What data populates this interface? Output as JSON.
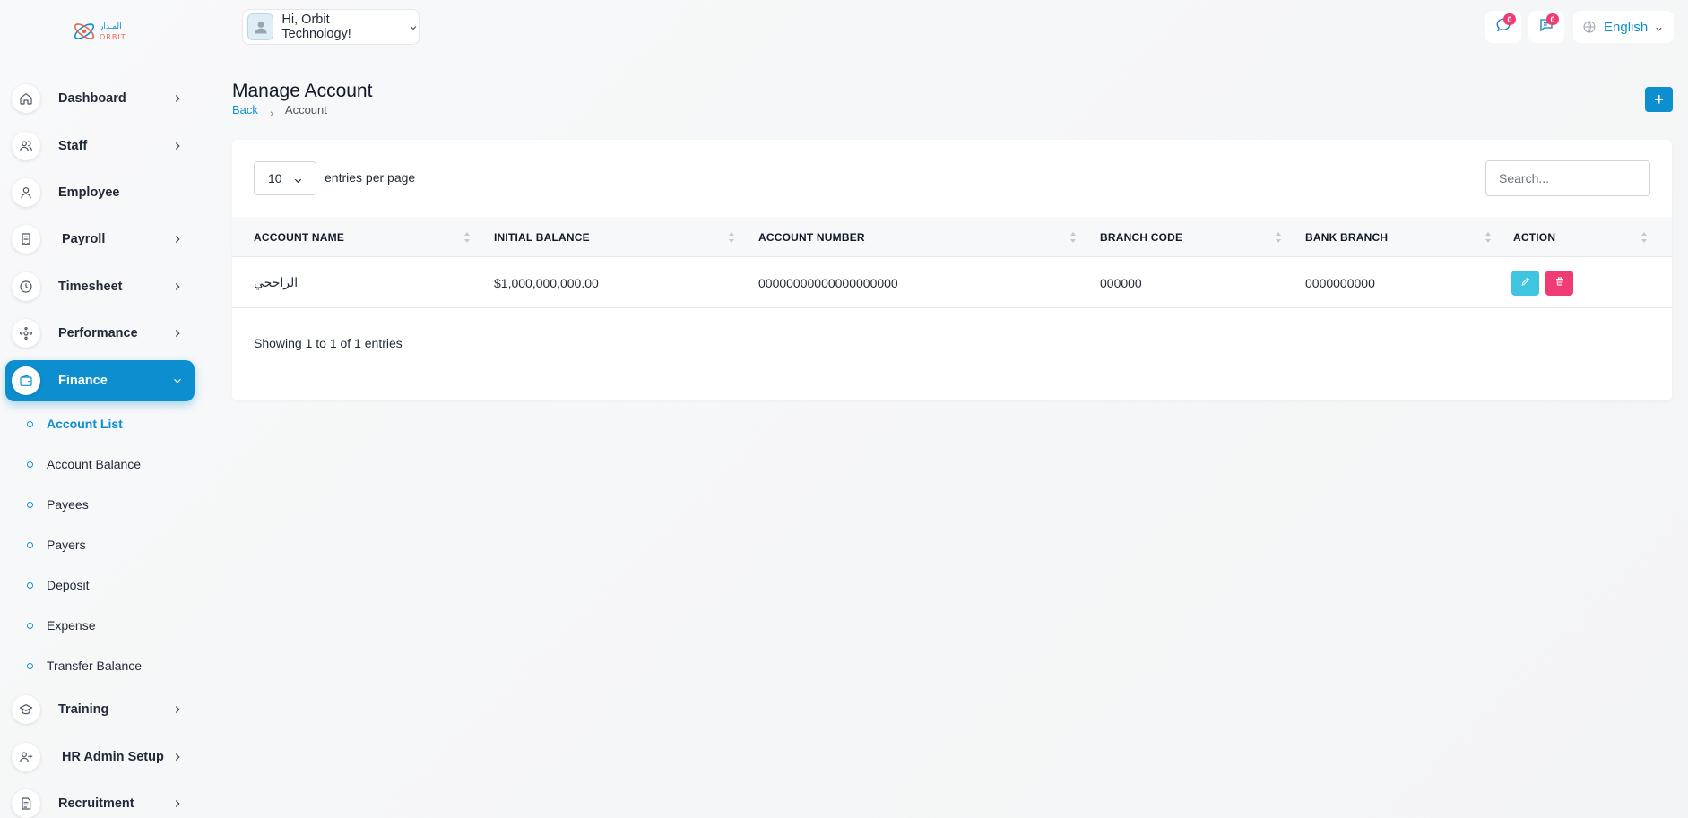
{
  "header": {
    "greeting": "Hi, Orbit Technology!",
    "language": "English",
    "chat_badge": "0",
    "messages_badge": "0"
  },
  "sidebar": {
    "items": [
      {
        "label": "Dashboard",
        "icon": "home-icon"
      },
      {
        "label": "Staff",
        "icon": "users-icon"
      },
      {
        "label": "Employee",
        "icon": "user-icon"
      },
      {
        "label": "Payroll",
        "icon": "receipt-icon"
      },
      {
        "label": "Timesheet",
        "icon": "clock-icon"
      },
      {
        "label": "Performance",
        "icon": "performance-icon"
      },
      {
        "label": "Finance",
        "icon": "wallet-icon"
      },
      {
        "label": "Training",
        "icon": "graduation-cap-icon"
      },
      {
        "label": "HR Admin Setup",
        "icon": "user-plus-icon"
      },
      {
        "label": "Recruitment",
        "icon": "document-icon"
      }
    ],
    "finance_subitems": [
      "Account List",
      "Account Balance",
      "Payees",
      "Payers",
      "Deposit",
      "Expense",
      "Transfer Balance"
    ]
  },
  "page": {
    "title": "Manage Account",
    "breadcrumb_back": "Back",
    "breadcrumb_current": "Account",
    "add_label": "+"
  },
  "table": {
    "entries_value": "10",
    "entries_label": "entries per page",
    "search_placeholder": "Search...",
    "columns": [
      "ACCOUNT NAME",
      "INITIAL BALANCE",
      "ACCOUNT NUMBER",
      "BRANCH CODE",
      "BANK BRANCH",
      "ACTION"
    ],
    "rows": [
      {
        "account_name": "الراجحي",
        "initial_balance": "$1,000,000,000.00",
        "account_number": "00000000000000000000",
        "branch_code": "000000",
        "bank_branch": "0000000000"
      }
    ],
    "footer_info": "Showing 1 to 1 of 1 entries"
  },
  "colors": {
    "accent": "#0d8ecf",
    "edit": "#3fc5e0",
    "delete": "#ef3c72"
  }
}
